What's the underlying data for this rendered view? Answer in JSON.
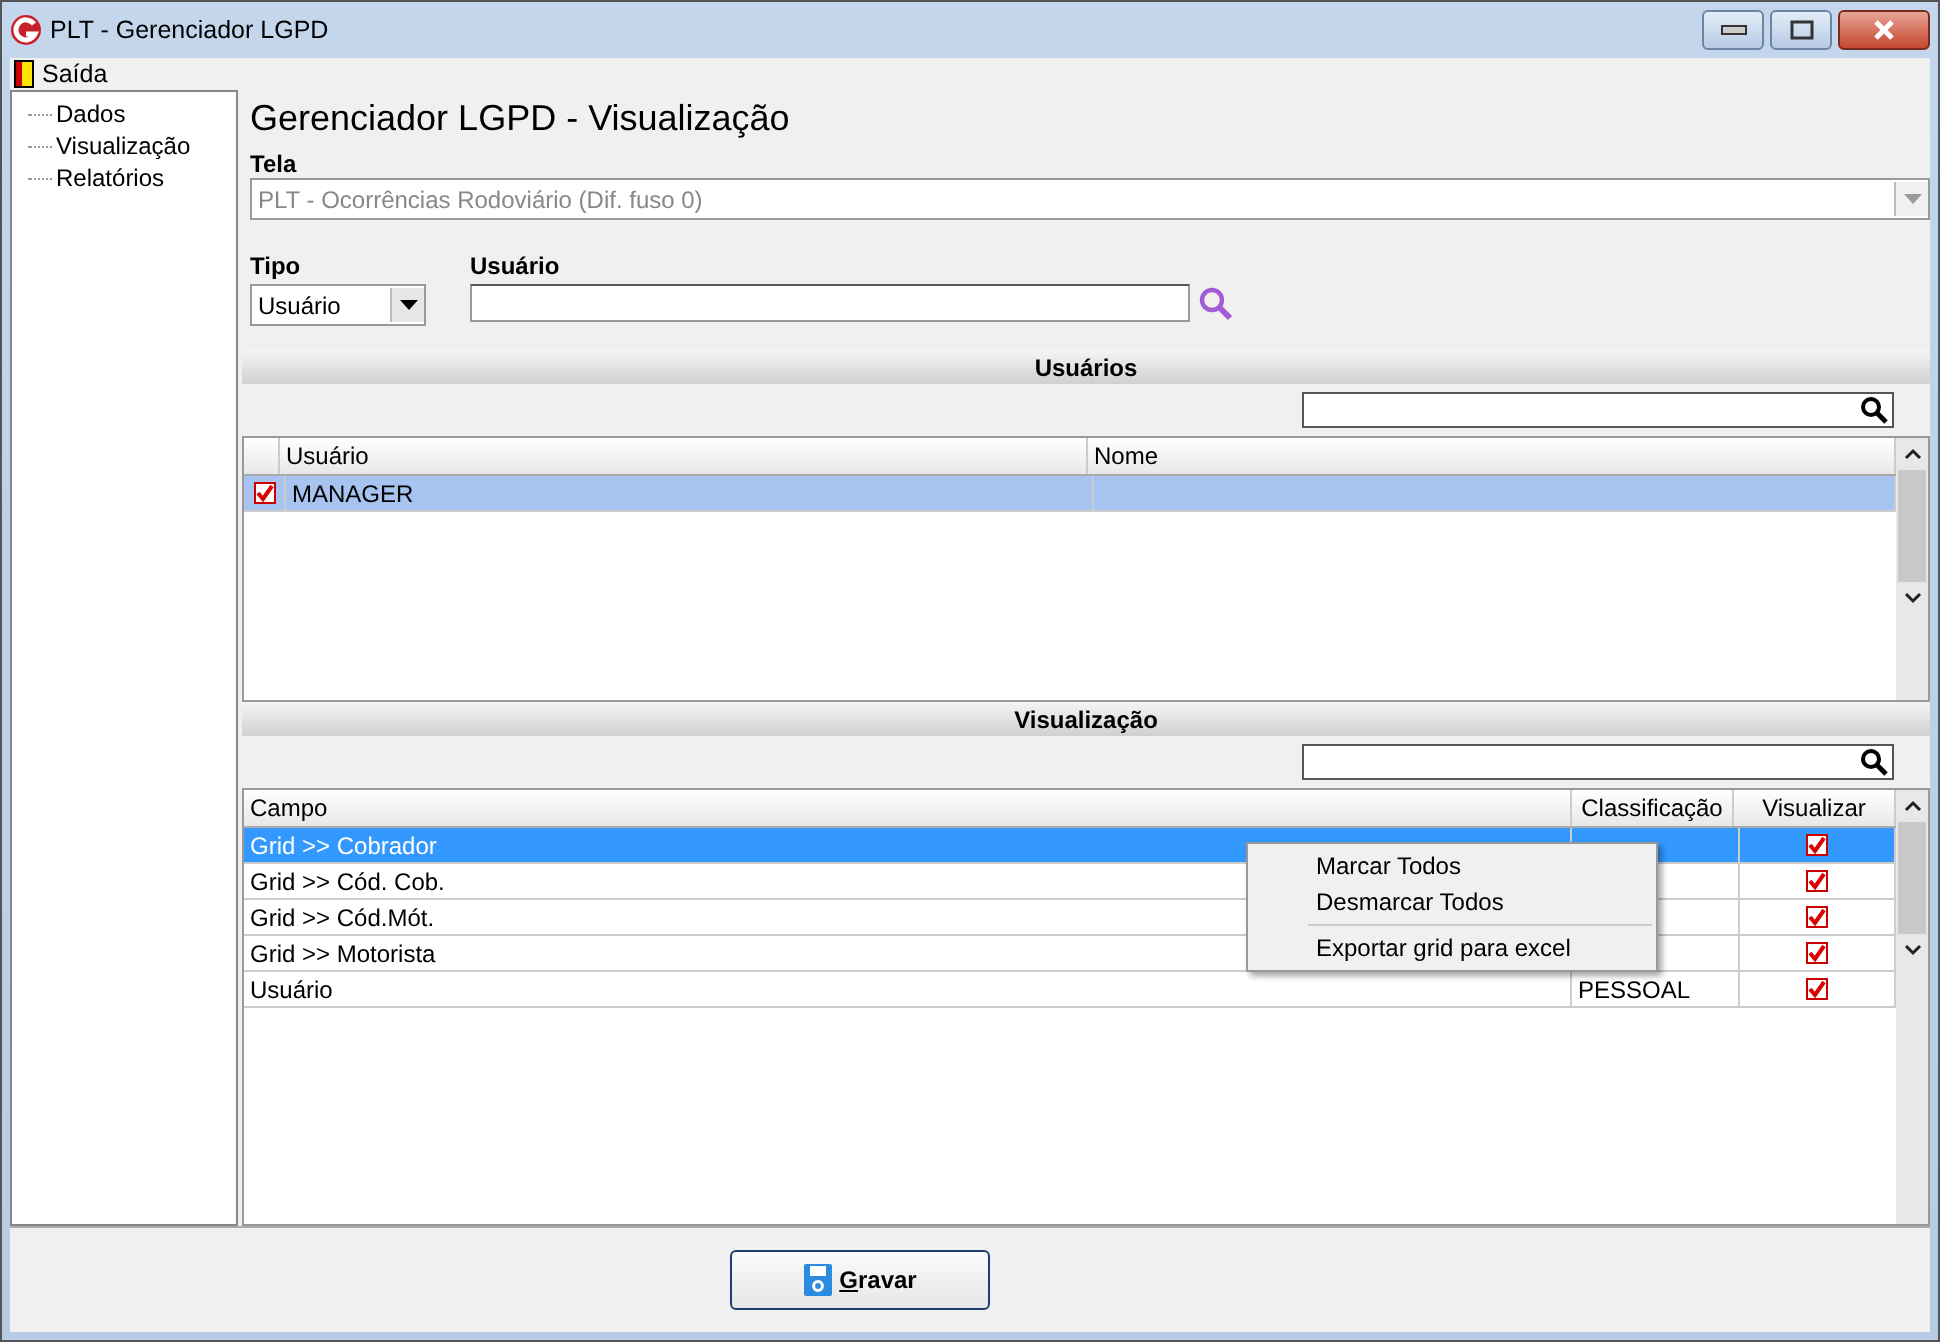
{
  "window": {
    "title": "PLT - Gerenciador LGPD"
  },
  "menu_bar": [
    {
      "label": "Saída"
    }
  ],
  "sidebar": {
    "items": [
      {
        "label": "Dados"
      },
      {
        "label": "Visualização"
      },
      {
        "label": "Relatórios"
      }
    ]
  },
  "page_title": "Gerenciador LGPD - Visualização",
  "tela": {
    "label": "Tela",
    "value": "PLT - Ocorrências Rodoviário (Dif. fuso 0)",
    "disabled": true
  },
  "tipo": {
    "label": "Tipo",
    "value": "Usuário"
  },
  "usuario": {
    "label": "Usuário"
  },
  "usuarios_section": {
    "title": "Usuários",
    "columns": [
      "Usuário",
      "Nome"
    ],
    "rows": [
      {
        "usuario": "MANAGER",
        "checked": true,
        "selected": true
      }
    ]
  },
  "visualizacao_section": {
    "title": "Visualização",
    "columns": [
      "Campo",
      "Classificação",
      "Visualizar"
    ],
    "rows": [
      {
        "campo": "Grid >> Cobrador",
        "visualizar": true,
        "selected": true
      },
      {
        "campo": "Grid >> Cód. Cob.",
        "visualizar": true,
        "selected": false
      },
      {
        "campo": "Grid >> Cód.Mót.",
        "visualizar": true,
        "selected": false
      },
      {
        "campo": "Grid >> Motorista",
        "visualizar": true,
        "selected": false
      },
      {
        "campo": "Usuário",
        "classificacao": "PESSOAL",
        "visualizar": true,
        "selected": false
      }
    ]
  },
  "context_menu": [
    {
      "kind": "item",
      "label": "Marcar Todos"
    },
    {
      "kind": "item",
      "label": "Desmarcar Todos"
    },
    {
      "kind": "separator"
    },
    {
      "kind": "item",
      "label": "Exportar grid para excel"
    }
  ],
  "save_button": {
    "label": "Gravar"
  }
}
